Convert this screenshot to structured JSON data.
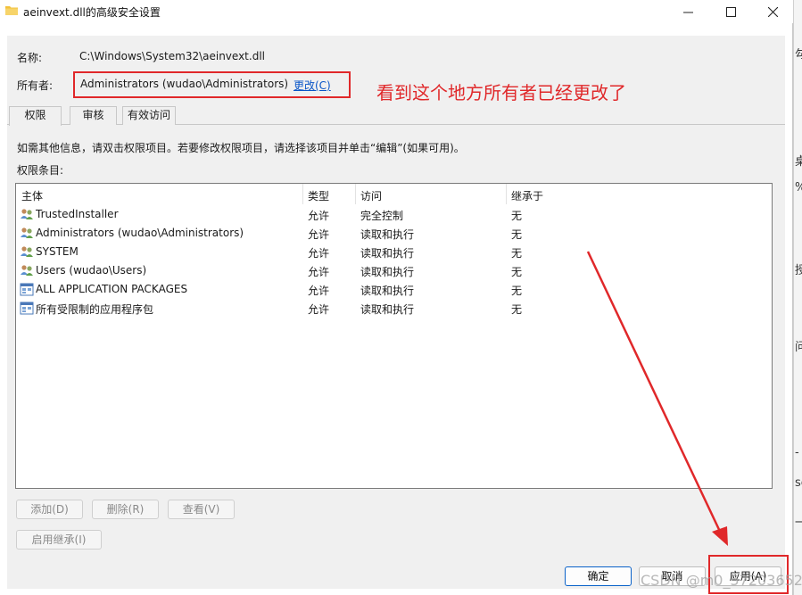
{
  "window": {
    "title": "aeinvext.dll的高级安全设置",
    "folder_icon_color": "#f3c23b"
  },
  "fields": {
    "name_label": "名称:",
    "name_value": "C:\\Windows\\System32\\aeinvext.dll",
    "owner_label": "所有者:",
    "owner_value": "Administrators (wudao\\Administrators)",
    "change_link": "更改(C)"
  },
  "annotation": {
    "text": "看到这个地方所有者已经更改了",
    "color": "#e0282a"
  },
  "tabs": [
    {
      "label": "权限",
      "active": true
    },
    {
      "label": "审核",
      "active": false
    },
    {
      "label": "有效访问",
      "active": false
    }
  ],
  "info_text": "如需其他信息，请双击权限项目。若要修改权限项目，请选择该项目并单击“编辑”(如果可用)。",
  "entries_label": "权限条目:",
  "table": {
    "columns": [
      "主体",
      "类型",
      "访问",
      "继承于"
    ],
    "rows": [
      {
        "principal": "TrustedInstaller",
        "type": "允许",
        "access": "完全控制",
        "inherited": "无",
        "icon": "users-icon"
      },
      {
        "principal": "Administrators (wudao\\Administrators)",
        "type": "允许",
        "access": "读取和执行",
        "inherited": "无",
        "icon": "users-icon"
      },
      {
        "principal": "SYSTEM",
        "type": "允许",
        "access": "读取和执行",
        "inherited": "无",
        "icon": "users-icon"
      },
      {
        "principal": "Users (wudao\\Users)",
        "type": "允许",
        "access": "读取和执行",
        "inherited": "无",
        "icon": "users-icon"
      },
      {
        "principal": "ALL APPLICATION PACKAGES",
        "type": "允许",
        "access": "读取和执行",
        "inherited": "无",
        "icon": "app-package-icon"
      },
      {
        "principal": "所有受限制的应用程序包",
        "type": "允许",
        "access": "读取和执行",
        "inherited": "无",
        "icon": "app-package-icon"
      }
    ]
  },
  "buttons": {
    "add": "添加(D)",
    "remove": "删除(R)",
    "view": "查看(V)",
    "enable_inheritance": "启用继承(I)",
    "ok": "确定",
    "cancel": "取消",
    "apply": "应用(A)"
  },
  "background_window": {
    "fragments": [
      "勾",
      "桌",
      "%",
      "授",
      "问",
      "-",
      "se",
      "一"
    ]
  },
  "watermark": "CSDN @m0_57203652"
}
